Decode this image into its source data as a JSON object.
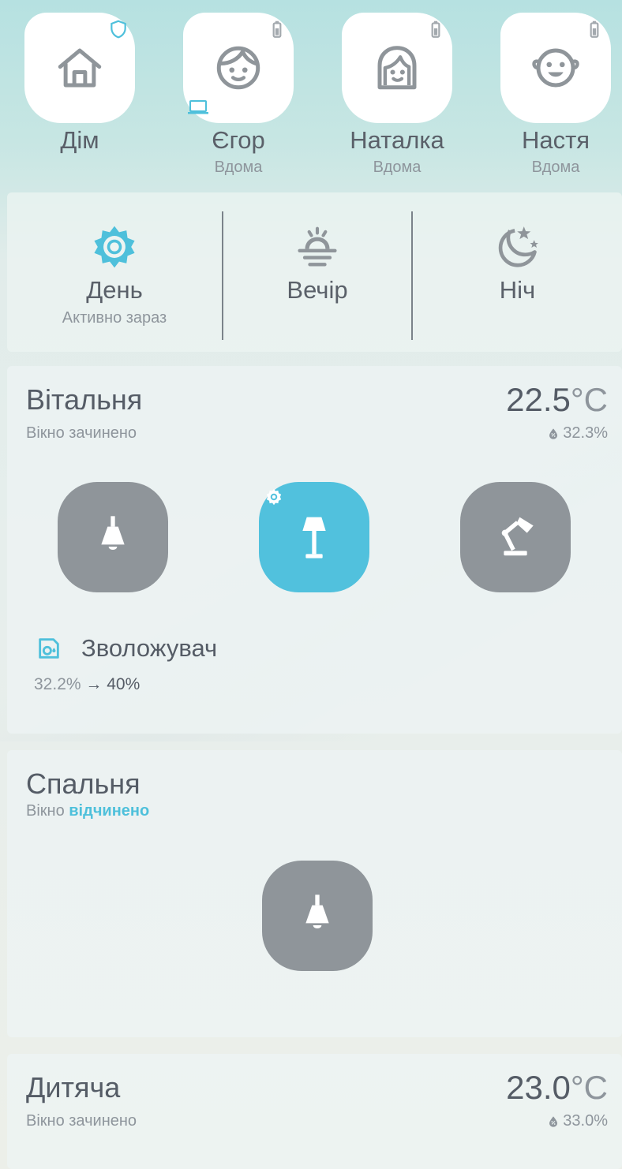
{
  "people": [
    {
      "name": "Дім",
      "status": "",
      "icon": "home-icon",
      "badge": "shield-icon"
    },
    {
      "name": "Єгор",
      "status": "Вдома",
      "icon": "boy-face-icon",
      "badge": "battery-icon",
      "extra_badge": "laptop-icon"
    },
    {
      "name": "Наталка",
      "status": "Вдома",
      "icon": "woman-face-icon",
      "badge": "battery-icon"
    },
    {
      "name": "Настя",
      "status": "Вдома",
      "icon": "baby-face-icon",
      "badge": "battery-icon"
    }
  ],
  "scenes": [
    {
      "label": "День",
      "sub": "Активно зараз",
      "icon": "sun-icon",
      "active": true
    },
    {
      "label": "Вечір",
      "sub": "",
      "icon": "sunset-icon",
      "active": false
    },
    {
      "label": "Ніч",
      "sub": "",
      "icon": "moon-stars-icon",
      "active": false
    }
  ],
  "rooms": [
    {
      "name": "Вітальня",
      "window": "Вікно зачинено",
      "temp": "22.5",
      "temp_unit": "°C",
      "humidity": "32.3%",
      "lights": [
        {
          "icon": "ceiling-lamp-icon",
          "on": false
        },
        {
          "icon": "floor-lamp-icon",
          "on": true,
          "badge": "gear-icon"
        },
        {
          "icon": "desk-lamp-icon",
          "on": false
        }
      ],
      "humidifier": {
        "name": "Зволожувач",
        "current": "32.2%",
        "arrow": "→",
        "target": "40%"
      }
    },
    {
      "name": "Спальня",
      "window_prefix": "Вікно",
      "window_state": "відчинено",
      "lights": [
        {
          "icon": "ceiling-lamp-icon",
          "on": false
        }
      ]
    },
    {
      "name": "Дитяча",
      "window": "Вікно зачинено",
      "temp": "23.0",
      "temp_unit": "°C",
      "humidity": "33.0%"
    }
  ],
  "colors": {
    "accent": "#4ec0db",
    "light_off": "#8f959a",
    "text": "#555c66",
    "muted": "#8e959c"
  }
}
